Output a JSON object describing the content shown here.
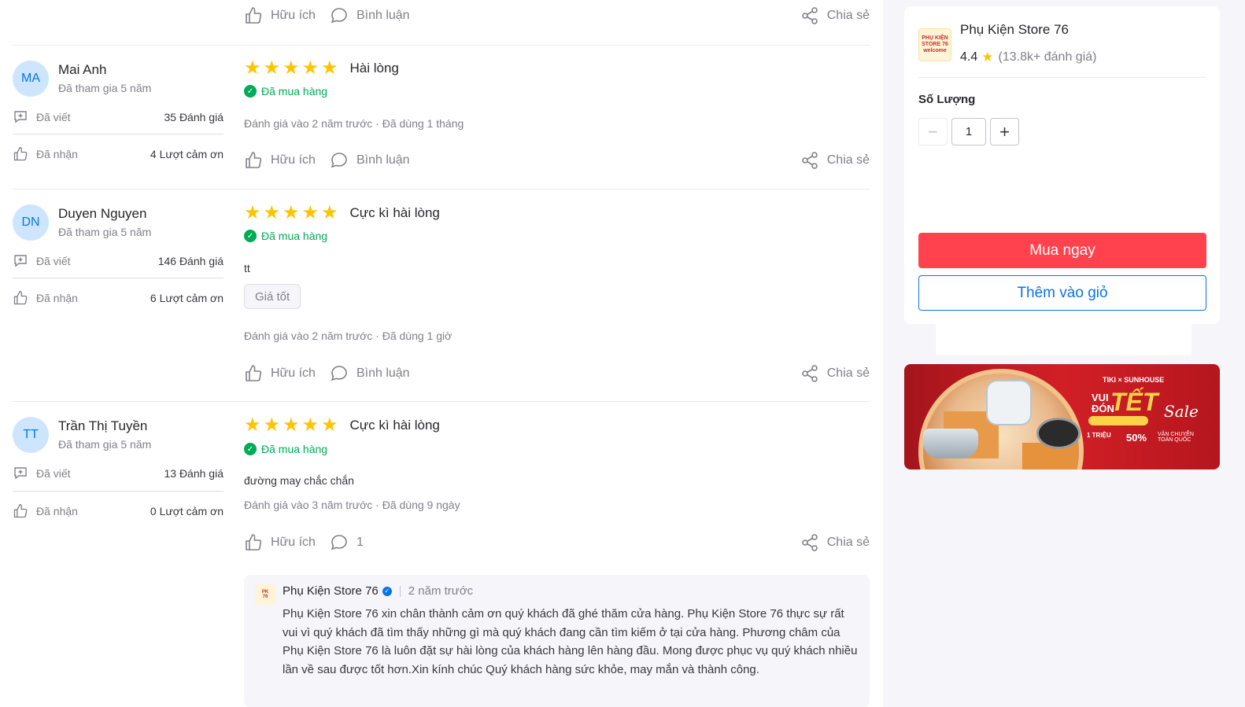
{
  "actions": {
    "helpful": "Hữu ích",
    "comment": "Bình luận",
    "share": "Chia sẻ"
  },
  "stat_labels": {
    "written": "Đã viết",
    "received": "Đã nhận"
  },
  "reviews": [
    {
      "initials": "MA",
      "name": "Mai Anh",
      "joined": "Đã tham gia 5 năm",
      "written_count": "35 Đánh giá",
      "thanks_count": "4 Lượt cảm ơn",
      "rating": 5,
      "title": "Hài lòng",
      "bought": "Đã mua hàng",
      "meta": "Đánh giá vào 2 năm trước  ·  Đã dùng 1 tháng",
      "comment_label": "Bình luận"
    },
    {
      "initials": "DN",
      "name": "Duyen Nguyen",
      "joined": "Đã tham gia 5 năm",
      "written_count": "146 Đánh giá",
      "thanks_count": "6 Lượt cảm ơn",
      "rating": 5,
      "title": "Cực kì hài lòng",
      "bought": "Đã mua hàng",
      "text": "tt",
      "tag": "Giá tốt",
      "meta": "Đánh giá vào 2 năm trước  ·  Đã dùng 1 giờ",
      "comment_label": "Bình luận"
    },
    {
      "initials": "TT",
      "name": "Trần Thị Tuyền",
      "joined": "Đã tham gia 5 năm",
      "written_count": "13 Đánh giá",
      "thanks_count": "0 Lượt cảm ơn",
      "rating": 5,
      "title": "Cực kì hài lòng",
      "bought": "Đã mua hàng",
      "text": "đường may chắc chắn",
      "meta": "Đánh giá vào 3 năm trước  ·  Đã dùng 9 ngày",
      "comment_label": "1"
    }
  ],
  "reply": {
    "seller": "Phụ Kiện Store 76",
    "time": "2 năm trước",
    "text": "Phụ Kiện Store 76 xin chân thành cảm ơn quý khách đã ghé thăm cửa hàng. Phụ Kiện Store 76 thực sự rất vui vì quý khách đã tìm thấy những gì mà quý khách đang cần tìm kiếm ở tại cửa hàng. Phương châm của Phụ Kiện Store 76 là luôn đặt sự hài lòng của khách hàng lên hàng đầu. Mong được phục vụ quý khách nhiều lần về sau được tốt hơn.Xin kính chúc Quý khách hàng sức khỏe, may mắn và thành công."
  },
  "store": {
    "name": "Phụ Kiện Store 76",
    "rating": "4.4",
    "rating_count": "(13.8k+ đánh giá)",
    "logo_text": "PHỤ KIỆN STORE 76 welcome"
  },
  "purchase": {
    "qty_label": "Số Lượng",
    "qty_value": "1",
    "buy_now": "Mua ngay",
    "add_to_cart": "Thêm vào giỏ"
  },
  "banner": {
    "top": "TIKI × SUNHOUSE",
    "vui_don": "VUI ĐÓN",
    "tet": "TẾT",
    "sale": "Sale",
    "b1": "1 TRIỆU",
    "b2": "50%",
    "b3": "VẬN CHUYỂN TOÀN QUỐC"
  },
  "colors": {
    "buy": "#ff424e",
    "accent": "#0b74e5",
    "star": "#ffc400",
    "bought": "#00ab56"
  }
}
